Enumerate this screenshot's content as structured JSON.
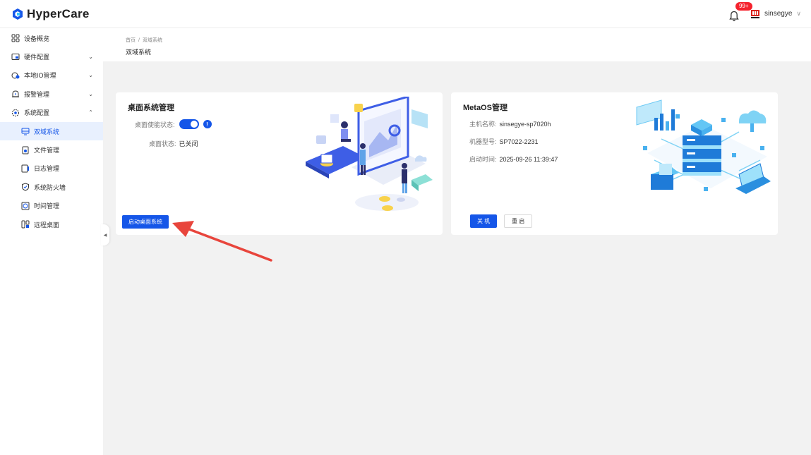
{
  "header": {
    "logo_text": "HyperCare",
    "notification_badge": "99+",
    "username": "sinsegye"
  },
  "sidebar": {
    "items": [
      {
        "label": "设备概览",
        "icon": "grid-icon"
      },
      {
        "label": "硬件配置",
        "icon": "monitor-icon",
        "expandable": true
      },
      {
        "label": "本地IO管理",
        "icon": "io-icon",
        "expandable": true
      },
      {
        "label": "报警管理",
        "icon": "alarm-icon",
        "expandable": true
      },
      {
        "label": "系统配置",
        "icon": "gear-icon",
        "expandable": true,
        "expanded": true
      }
    ],
    "sub_items": [
      {
        "label": "双域系统",
        "icon": "dual-domain-icon",
        "active": true
      },
      {
        "label": "文件管理",
        "icon": "file-icon"
      },
      {
        "label": "日志管理",
        "icon": "log-icon"
      },
      {
        "label": "系统防火墙",
        "icon": "shield-icon"
      },
      {
        "label": "时间管理",
        "icon": "clock-icon"
      },
      {
        "label": "远程桌面",
        "icon": "remote-desktop-icon"
      }
    ]
  },
  "breadcrumb": {
    "home": "首页",
    "separator": "/",
    "current": "双域系统"
  },
  "page_title": "双域系统",
  "desktop_card": {
    "title": "桌面系统管理",
    "enable_label": "桌面使能状态:",
    "enable_on": true,
    "status_label": "桌面状态:",
    "status_value": "已关闭",
    "start_button": "启动桌面系统"
  },
  "metaos_card": {
    "title": "MetaOS管理",
    "host_label": "主机名称:",
    "host_value": "sinsegye-sp7020h",
    "model_label": "机器型号:",
    "model_value": "SP7022-2231",
    "boot_label": "启动时间:",
    "boot_value": "2025-09-26 11:39:47",
    "shutdown_button": "关 机",
    "restart_button": "重 启"
  },
  "colors": {
    "primary": "#1556e8",
    "badge": "#f5222d",
    "annotation_arrow": "#e8453c"
  }
}
